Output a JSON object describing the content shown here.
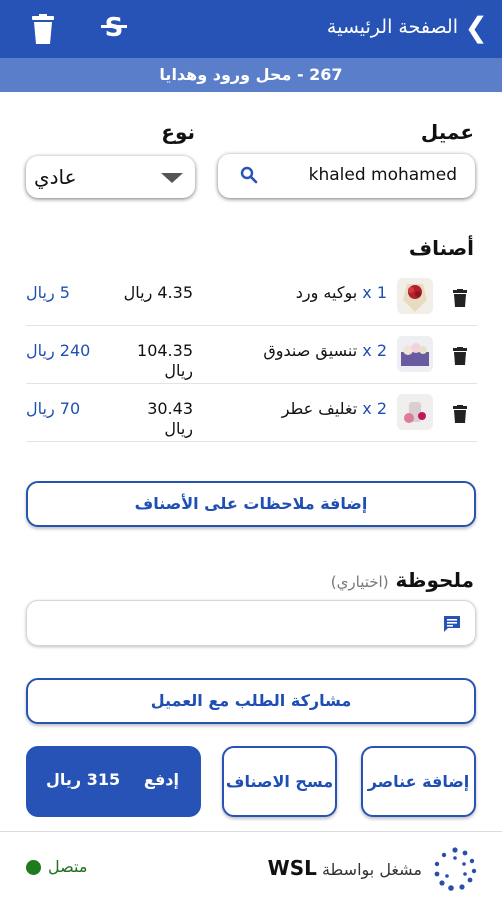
{
  "header": {
    "title": "الصفحة الرئيسية",
    "back_glyph": "❮",
    "clear_glyph": "S",
    "store": "267 - محل ورود وهدايا"
  },
  "form": {
    "customer_label": "عميل",
    "customer_value": "khaled mohamed",
    "type_label": "نوع",
    "type_value": "عادي"
  },
  "items": {
    "heading": "أصناف",
    "rows": [
      {
        "qty": "1 x",
        "name": "بوكيه ورد",
        "price": "4.35 ريال",
        "total": "5 ريال"
      },
      {
        "qty": "2 x",
        "name": "تنسيق صندوق",
        "price": "104.35 ريال",
        "total": "240 ريال"
      },
      {
        "qty": "2 x",
        "name": "تغليف عطر",
        "price": "30.43 ريال",
        "total": "70 ريال"
      }
    ]
  },
  "actions": {
    "add_notes": "إضافة ملاحظات على الأصناف",
    "note_label": "ملحوظة",
    "note_optional": "(اختياري)",
    "share": "مشاركة الطلب مع العميل",
    "add_items": "إضافة عناصر",
    "clear_items": "مسح الاصناف",
    "pay_label": "إدفع",
    "pay_amount": "315 ريال"
  },
  "footer": {
    "powered": "مشغل بواسطة",
    "brand": "WSL",
    "status": "متصل",
    "status_color": "#1e7b1e"
  },
  "colors": {
    "primary": "#2753b6",
    "subbar": "#5a7ec9",
    "link": "#1f4fb5"
  }
}
